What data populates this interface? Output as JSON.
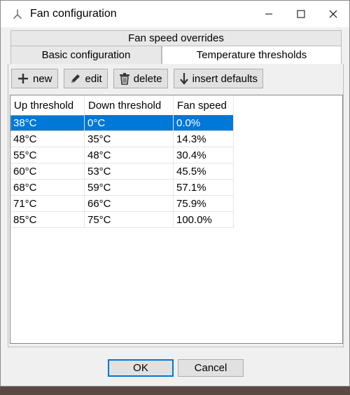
{
  "window": {
    "title": "Fan configuration",
    "app_icon": "wrench-fan-icon",
    "controls": [
      "minimize-icon",
      "maximize-icon",
      "close-icon"
    ]
  },
  "tabs": {
    "back_row": "Fan speed overrides",
    "front_row": [
      {
        "label": "Basic configuration",
        "selected": false
      },
      {
        "label": "Temperature thresholds",
        "selected": true
      }
    ]
  },
  "toolbar": {
    "new_label": "new",
    "edit_label": "edit",
    "delete_label": "delete",
    "insert_defaults_label": "insert defaults"
  },
  "table": {
    "columns": [
      "Up threshold",
      "Down threshold",
      "Fan speed"
    ],
    "rows": [
      [
        "38°C",
        "0°C",
        "0.0%"
      ],
      [
        "48°C",
        "35°C",
        "14.3%"
      ],
      [
        "55°C",
        "48°C",
        "30.4%"
      ],
      [
        "60°C",
        "53°C",
        "45.5%"
      ],
      [
        "68°C",
        "59°C",
        "57.1%"
      ],
      [
        "71°C",
        "66°C",
        "75.9%"
      ],
      [
        "85°C",
        "75°C",
        "100.0%"
      ]
    ],
    "selected_row": 0
  },
  "footer": {
    "ok_label": "OK",
    "cancel_label": "Cancel"
  },
  "colors": {
    "selection": "#0078d7",
    "window_bg": "#f0f0f0"
  }
}
